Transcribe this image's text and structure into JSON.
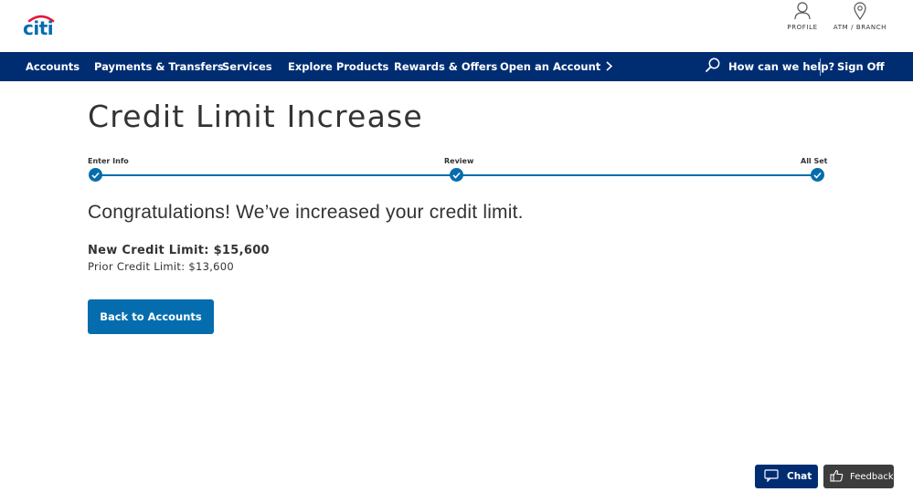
{
  "brand": {
    "logo_text": "citi",
    "colors": {
      "navy": "#002d72",
      "blue": "#056dae",
      "arc_red": "#e31937",
      "dark_gray": "#3d3d3d"
    }
  },
  "utility_links": {
    "profile": {
      "label": "PROFILE",
      "icon": "person-icon"
    },
    "atm": {
      "label": "ATM / BRANCH",
      "icon": "location-pin-icon"
    }
  },
  "nav": {
    "items": [
      {
        "label": "Accounts"
      },
      {
        "label": "Payments & Transfers"
      },
      {
        "label": "Services"
      },
      {
        "label": "Explore Products"
      },
      {
        "label": "Rewards & Offers"
      },
      {
        "label": "Open an Account"
      }
    ],
    "help_label": "How can we help?",
    "signoff_label": "Sign Off"
  },
  "page": {
    "title": "Credit Limit Increase",
    "steps": [
      {
        "label": "Enter Info",
        "state": "complete"
      },
      {
        "label": "Review",
        "state": "complete"
      },
      {
        "label": "All Set",
        "state": "complete"
      }
    ],
    "congrats": "Congratulations! We’ve increased your credit limit.",
    "new_limit": "New Credit Limit: $15,600",
    "prior_limit": "Prior Credit Limit: $13,600",
    "back_button": "Back to Accounts"
  },
  "floating": {
    "chat_label": "Chat",
    "feedback_label": "Feedback"
  }
}
